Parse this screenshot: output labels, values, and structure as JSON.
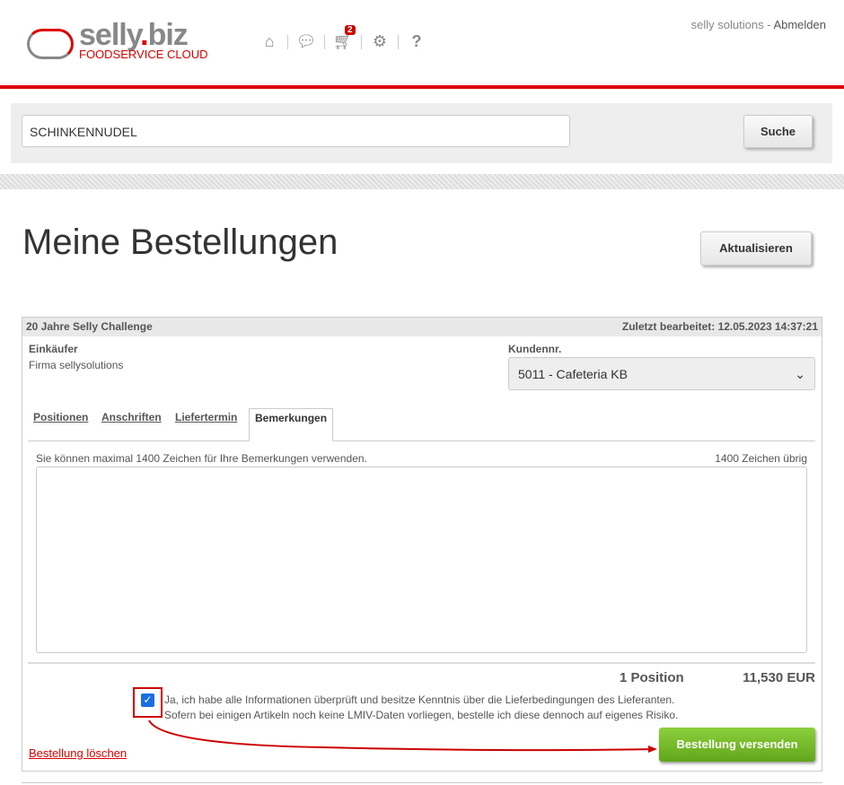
{
  "header": {
    "logo_main": "selly",
    "logo_dot": ".",
    "logo_biz": "biz",
    "logo_sub": "FOODSERVICE CLOUD",
    "cart_count": "2",
    "user": "selly solutions",
    "sep": " - ",
    "logout": "Abmelden"
  },
  "search": {
    "value": "SCHINKENNUDEL",
    "button": "Suche"
  },
  "page": {
    "title": "Meine Bestellungen",
    "refresh": "Aktualisieren"
  },
  "order": {
    "name": "20 Jahre Selly Challenge",
    "last_edited": "Zuletzt bearbeitet: 12.05.2023 14:37:21",
    "buyer_label": "Einkäufer",
    "buyer": "Firma sellysolutions",
    "customer_label": "Kundennr.",
    "customer": "5011 - Cafeteria KB",
    "tabs": [
      "Positionen",
      "Anschriften",
      "Liefertermin",
      "Bemerkungen"
    ],
    "remarks_hint": "Sie können maximal 1400 Zeichen für Ihre Bemerkungen verwenden.",
    "remarks_left": "1400 Zeichen übrig",
    "positions": "1 Position",
    "total": "11,530 EUR",
    "confirm_1": "Ja, ich habe alle Informationen überprüft und besitze Kenntnis über die Lieferbedingungen des Lieferanten.",
    "confirm_2": "Sofern bei einigen Artikeln noch keine LMIV-Daten vorliegen, bestelle ich diese dennoch auf eigenes Risiko.",
    "delete": "Bestellung löschen",
    "send": "Bestellung versenden"
  }
}
